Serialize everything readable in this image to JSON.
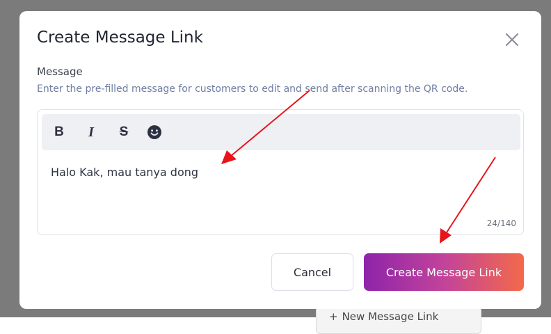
{
  "background": {
    "new_link_button_label": "New Message Link",
    "new_link_icon": "plus-icon"
  },
  "dialog": {
    "title": "Create Message Link",
    "close_icon": "close-icon",
    "message_label": "Message",
    "message_help": "Enter the pre-filled message for customers to edit and send after scanning the QR code.",
    "toolbar": {
      "bold_label": "B",
      "italic_label": "I",
      "strike_label": "S",
      "emoji_icon": "emoji-icon"
    },
    "message_value": "Halo Kak, mau tanya dong",
    "char_count": "24/140",
    "cancel_label": "Cancel",
    "create_label": "Create Message Link"
  },
  "colors": {
    "overlay": "#7b7b7b",
    "help_text": "#6e7da3",
    "gradient_start": "#8e24aa",
    "gradient_end": "#f4694a",
    "annotation_arrow": "#e8141b"
  }
}
